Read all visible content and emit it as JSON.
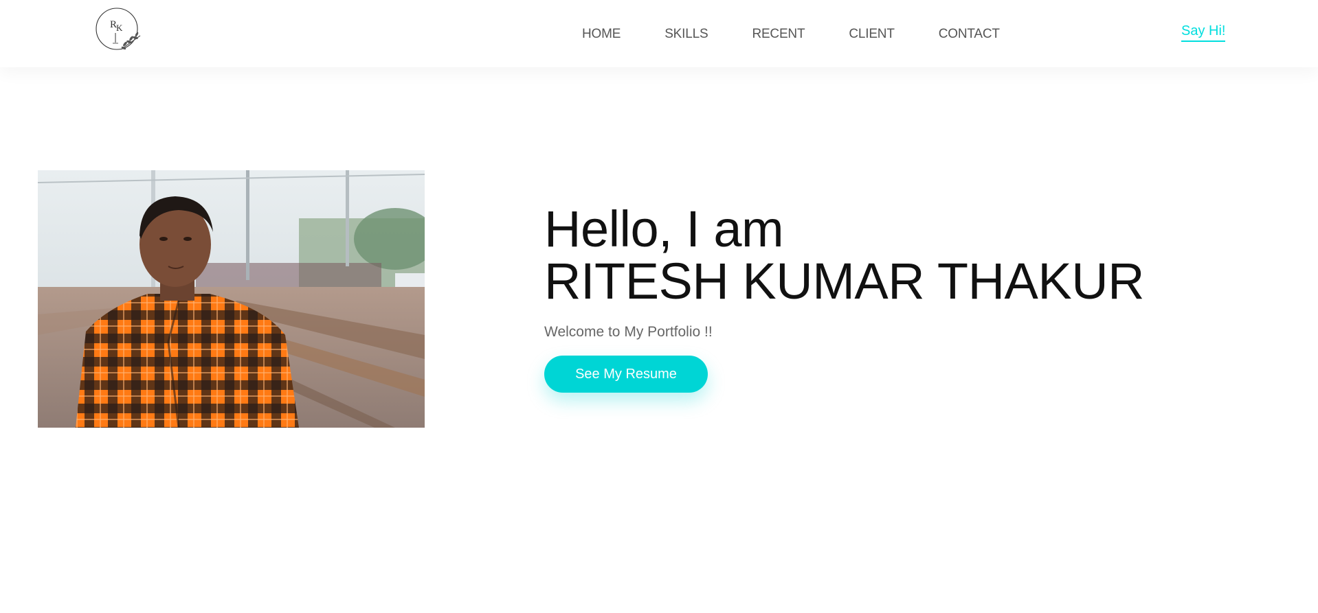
{
  "nav": {
    "logo_icon": "rk-monogram-circle-logo",
    "links": [
      "HOME",
      "SKILLS",
      "RECENT",
      "CLIENT",
      "CONTACT"
    ],
    "cta_label": "Say Hi!"
  },
  "hero": {
    "photo_icon": "portrait-photo",
    "greeting": "Hello, I am",
    "name": "RITESH KUMAR THAKUR",
    "tagline": "Welcome to My Portfolio !!",
    "button_label": "See My Resume"
  },
  "colors": {
    "accent": "#00d5d5",
    "link": "#00dede",
    "text": "#111111",
    "muted": "#666666"
  }
}
